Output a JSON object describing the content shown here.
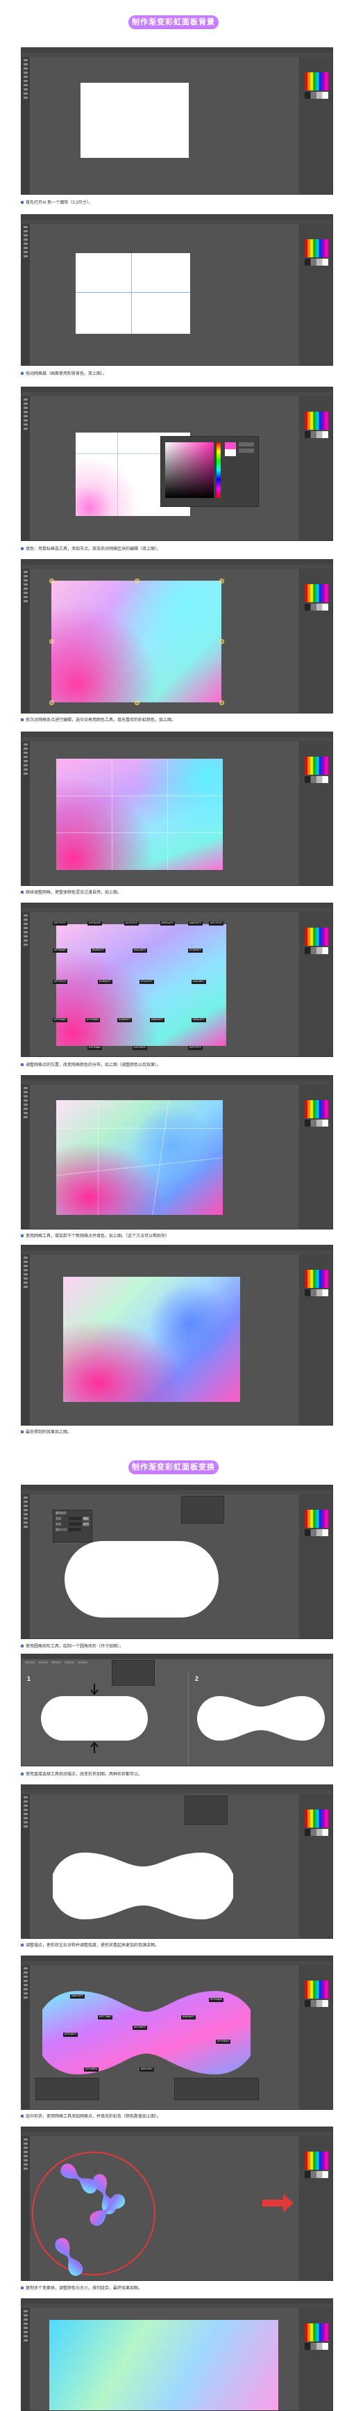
{
  "sections": [
    {
      "banner": "制作渐变彩虹面板背景"
    },
    {
      "banner": "制作渐变彩虹面板变换体"
    }
  ],
  "captions": [
    "首先打开AI 新一个面布（3:2尺寸）。",
    "拖动网格描（画面使用和背景色，双上图）。",
    "填色：用鼠标框选工具，添加节点。双击后对网格区块的编辑（双上图）。",
    "依次对网格各点进行编辑，选中点再用颜色工具，填充喜欢的彩虹颜色，如上图。",
    "继续调整网格，使整体颜色混合过渡自然，如上图。",
    "调整网格点的位置，改变网格颜色的分布，如上图（调整颜色以后效果）。",
    "使用网格工具，增加若干个新网格点并填色，如上图。（这个方法可以帮助你）",
    "最后得到的效果如上图。",
    "使用圆角矩形工具，绘制一个圆角矩形（尺寸如图）。",
    "使用直接选择工具拖动锚点，改变形状如图，两种形状都可以。",
    "调整锚点，使形状左右对称并调整弧度，使形状看起来更加的饱满流畅。",
    "选中形状，使用网格工具添加网格点，并填充彩虹色（颜色数值如上图）。",
    "复制多个变换体，调整颜色与大小，排列组合，最终效果如图。"
  ],
  "mesh_tags": [
    "#ffffff",
    "#ff9cf0",
    "#c7e7ff",
    "#8fbcff",
    "#a8f2ff",
    "#ffffff",
    "#ff6ad5",
    "#b18cff",
    "#9ce8ff",
    "#7de6ff",
    "#ff4fc4",
    "#c06cff",
    "#7ecbff",
    "#4ed9ff",
    "#ff35a0",
    "#ff58d0",
    "#c684ff",
    "#8bb0ff",
    "#6be0ff",
    "#ff2d9a",
    "#ffd4f2",
    "#ffffff"
  ],
  "shape_tags": [
    "#9af3ff",
    "#ff7de9",
    "#ffb0ff",
    "#b7a8ff",
    "#8e9dff",
    "#ffa3e8",
    "#ff69cd",
    "#6fe3ff",
    "#ffe6fa"
  ],
  "dialog": {
    "title": "圆角矩形",
    "width_label": "宽度：",
    "height_label": "高度：",
    "radius_label": "圆角半径：",
    "ok": "确定",
    "cancel": "取消"
  },
  "step_labels": [
    "1",
    "2"
  ],
  "colors": {
    "banner": "#c77dff",
    "workspace": "#535353",
    "panel": "#454545",
    "accent": "#ff2f92"
  }
}
